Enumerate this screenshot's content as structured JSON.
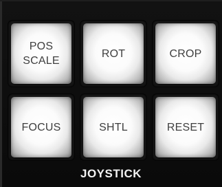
{
  "panel": {
    "section_label": "JOYSTICK",
    "keys": [
      {
        "label": "POS\nSCALE"
      },
      {
        "label": "ROT"
      },
      {
        "label": "CROP"
      },
      {
        "label": "FOCUS"
      },
      {
        "label": "SHTL"
      },
      {
        "label": "RESET"
      }
    ]
  },
  "colors": {
    "panel_background": "#0b0b0b",
    "key_face": "#ffffff",
    "key_text": "#3e3e3e",
    "section_label_text": "#f2f2f2"
  }
}
